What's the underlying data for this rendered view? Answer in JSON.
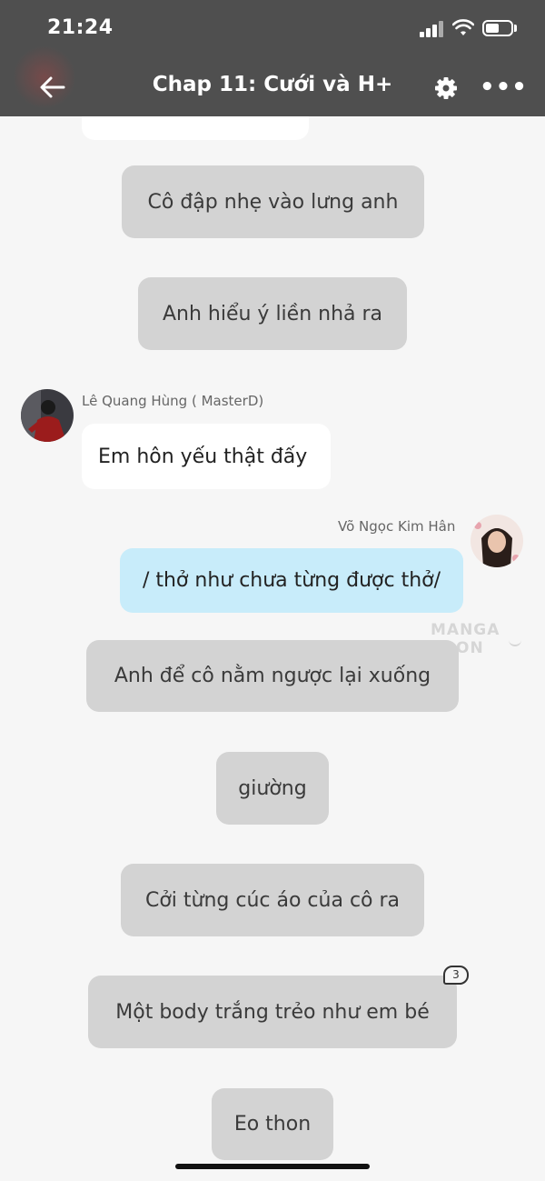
{
  "status": {
    "time": "21:24"
  },
  "header": {
    "title": "Chap 11: Cưới và H+"
  },
  "messages": {
    "m1": "Cô đập nhẹ vào lưng anh",
    "m2": "Anh hiểu ý liền nhả ra",
    "m3_author": "Lê Quang Hùng ( MasterD)",
    "m3": "Em hôn yếu thật đấy",
    "m4_author": "Võ Ngọc Kim Hân",
    "m4": "/ thở như chưa từng được thở/",
    "m5": "Anh để cô nằm ngược lại xuống",
    "m6": "giường",
    "m7": "Cởi từng cúc áo của cô ra",
    "m8": "Một body trắng trẻo như em bé",
    "m8_comments": "3",
    "m9": "Eo thon"
  },
  "watermark": "MANGA TOON",
  "colors": {
    "header": "#4f4f4f",
    "narration": "#d3d3d3",
    "reply": "#c8ecfa",
    "background": "#f6f6f6"
  }
}
